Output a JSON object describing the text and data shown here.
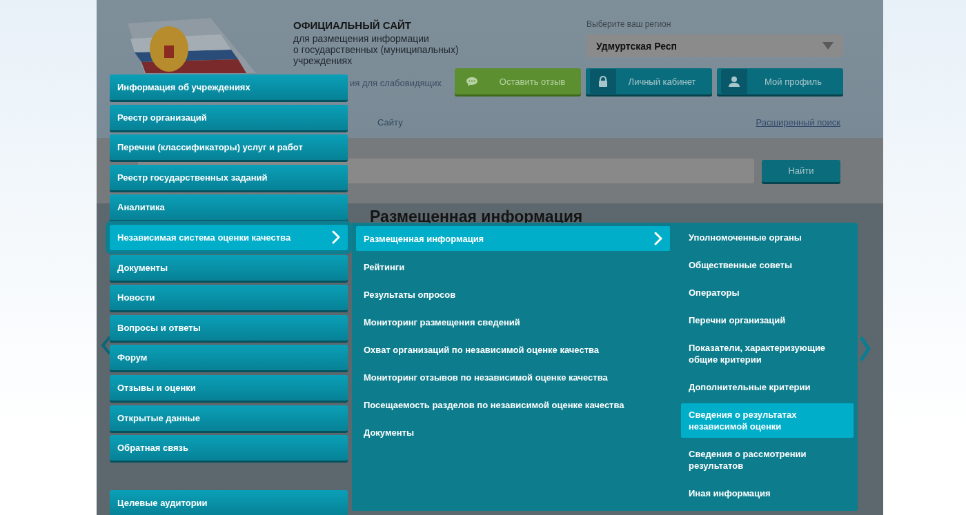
{
  "header": {
    "title": "ОФИЦИАЛЬНЫЙ САЙТ",
    "subtitle_lines": [
      "для размещения информации",
      "о государственных (муниципальных)",
      "учреждениях"
    ],
    "accessibility_link": "ия для слабовидящих",
    "region_label": "Выберите ваш регион",
    "region_value": "Удмуртская Респ",
    "buttons": [
      {
        "kind": "feedback",
        "label": "Оставить отзыв"
      },
      {
        "kind": "cabinet",
        "label": "Личный кабинет"
      },
      {
        "kind": "profile",
        "label": "Мой профиль"
      }
    ]
  },
  "search": {
    "scope_text": "Сайту",
    "advanced_link": "Расширенный поиск",
    "button": "Найти"
  },
  "main": {
    "heading": "Размещенная информация"
  },
  "menu": {
    "items": [
      {
        "label": "Информация об учреждениях",
        "selected": false,
        "kind": "item"
      },
      {
        "label": "Реестр организаций",
        "selected": false,
        "kind": "item"
      },
      {
        "label": "Перечни (классификаторы) услуг и работ",
        "selected": false,
        "kind": "item"
      },
      {
        "label": "Реестр государственных заданий",
        "selected": false,
        "kind": "item"
      },
      {
        "label": "Аналитика",
        "selected": false,
        "kind": "item"
      },
      {
        "label": "Независимая система оценки качества",
        "selected": true,
        "kind": "item"
      },
      {
        "label": "Документы",
        "selected": false,
        "kind": "item"
      },
      {
        "label": "Новости",
        "selected": false,
        "kind": "item"
      },
      {
        "label": "Вопросы и ответы",
        "selected": false,
        "kind": "item"
      },
      {
        "label": "Форум",
        "selected": false,
        "kind": "item"
      },
      {
        "label": "Отзывы и оценки",
        "selected": false,
        "kind": "item"
      },
      {
        "label": "Открытые данные",
        "selected": false,
        "kind": "item"
      },
      {
        "label": "Обратная связь",
        "selected": false,
        "kind": "item"
      },
      {
        "label": "Целевые аудитории",
        "selected": false,
        "kind": "separated"
      }
    ],
    "submenu": [
      {
        "label": "Размещенная информация",
        "selected": true
      },
      {
        "label": "Рейтинги",
        "selected": false
      },
      {
        "label": "Результаты опросов",
        "selected": false
      },
      {
        "label": "Мониторинг размещения сведений",
        "selected": false
      },
      {
        "label": "Охват организаций по независимой оценке качества",
        "selected": false
      },
      {
        "label": "Мониторинг отзывов по независимой оценке качества",
        "selected": false
      },
      {
        "label": "Посещаемость разделов по независимой оценке качества",
        "selected": false
      },
      {
        "label": "Документы",
        "selected": false
      }
    ],
    "subsubmenu": [
      {
        "label": "Уполномоченные органы",
        "selected": false
      },
      {
        "label": "Общественные советы",
        "selected": false
      },
      {
        "label": "Операторы",
        "selected": false
      },
      {
        "label": "Перечни организаций",
        "selected": false
      },
      {
        "label": "Показатели, характеризующие общие критерии",
        "selected": false
      },
      {
        "label": "Дополнительные критерии",
        "selected": false
      },
      {
        "label": "Сведения о результатах независимой оценки",
        "selected": true
      },
      {
        "label": "Сведения о рассмотрении результатов",
        "selected": false
      },
      {
        "label": "Иная информация",
        "selected": false
      }
    ]
  }
}
